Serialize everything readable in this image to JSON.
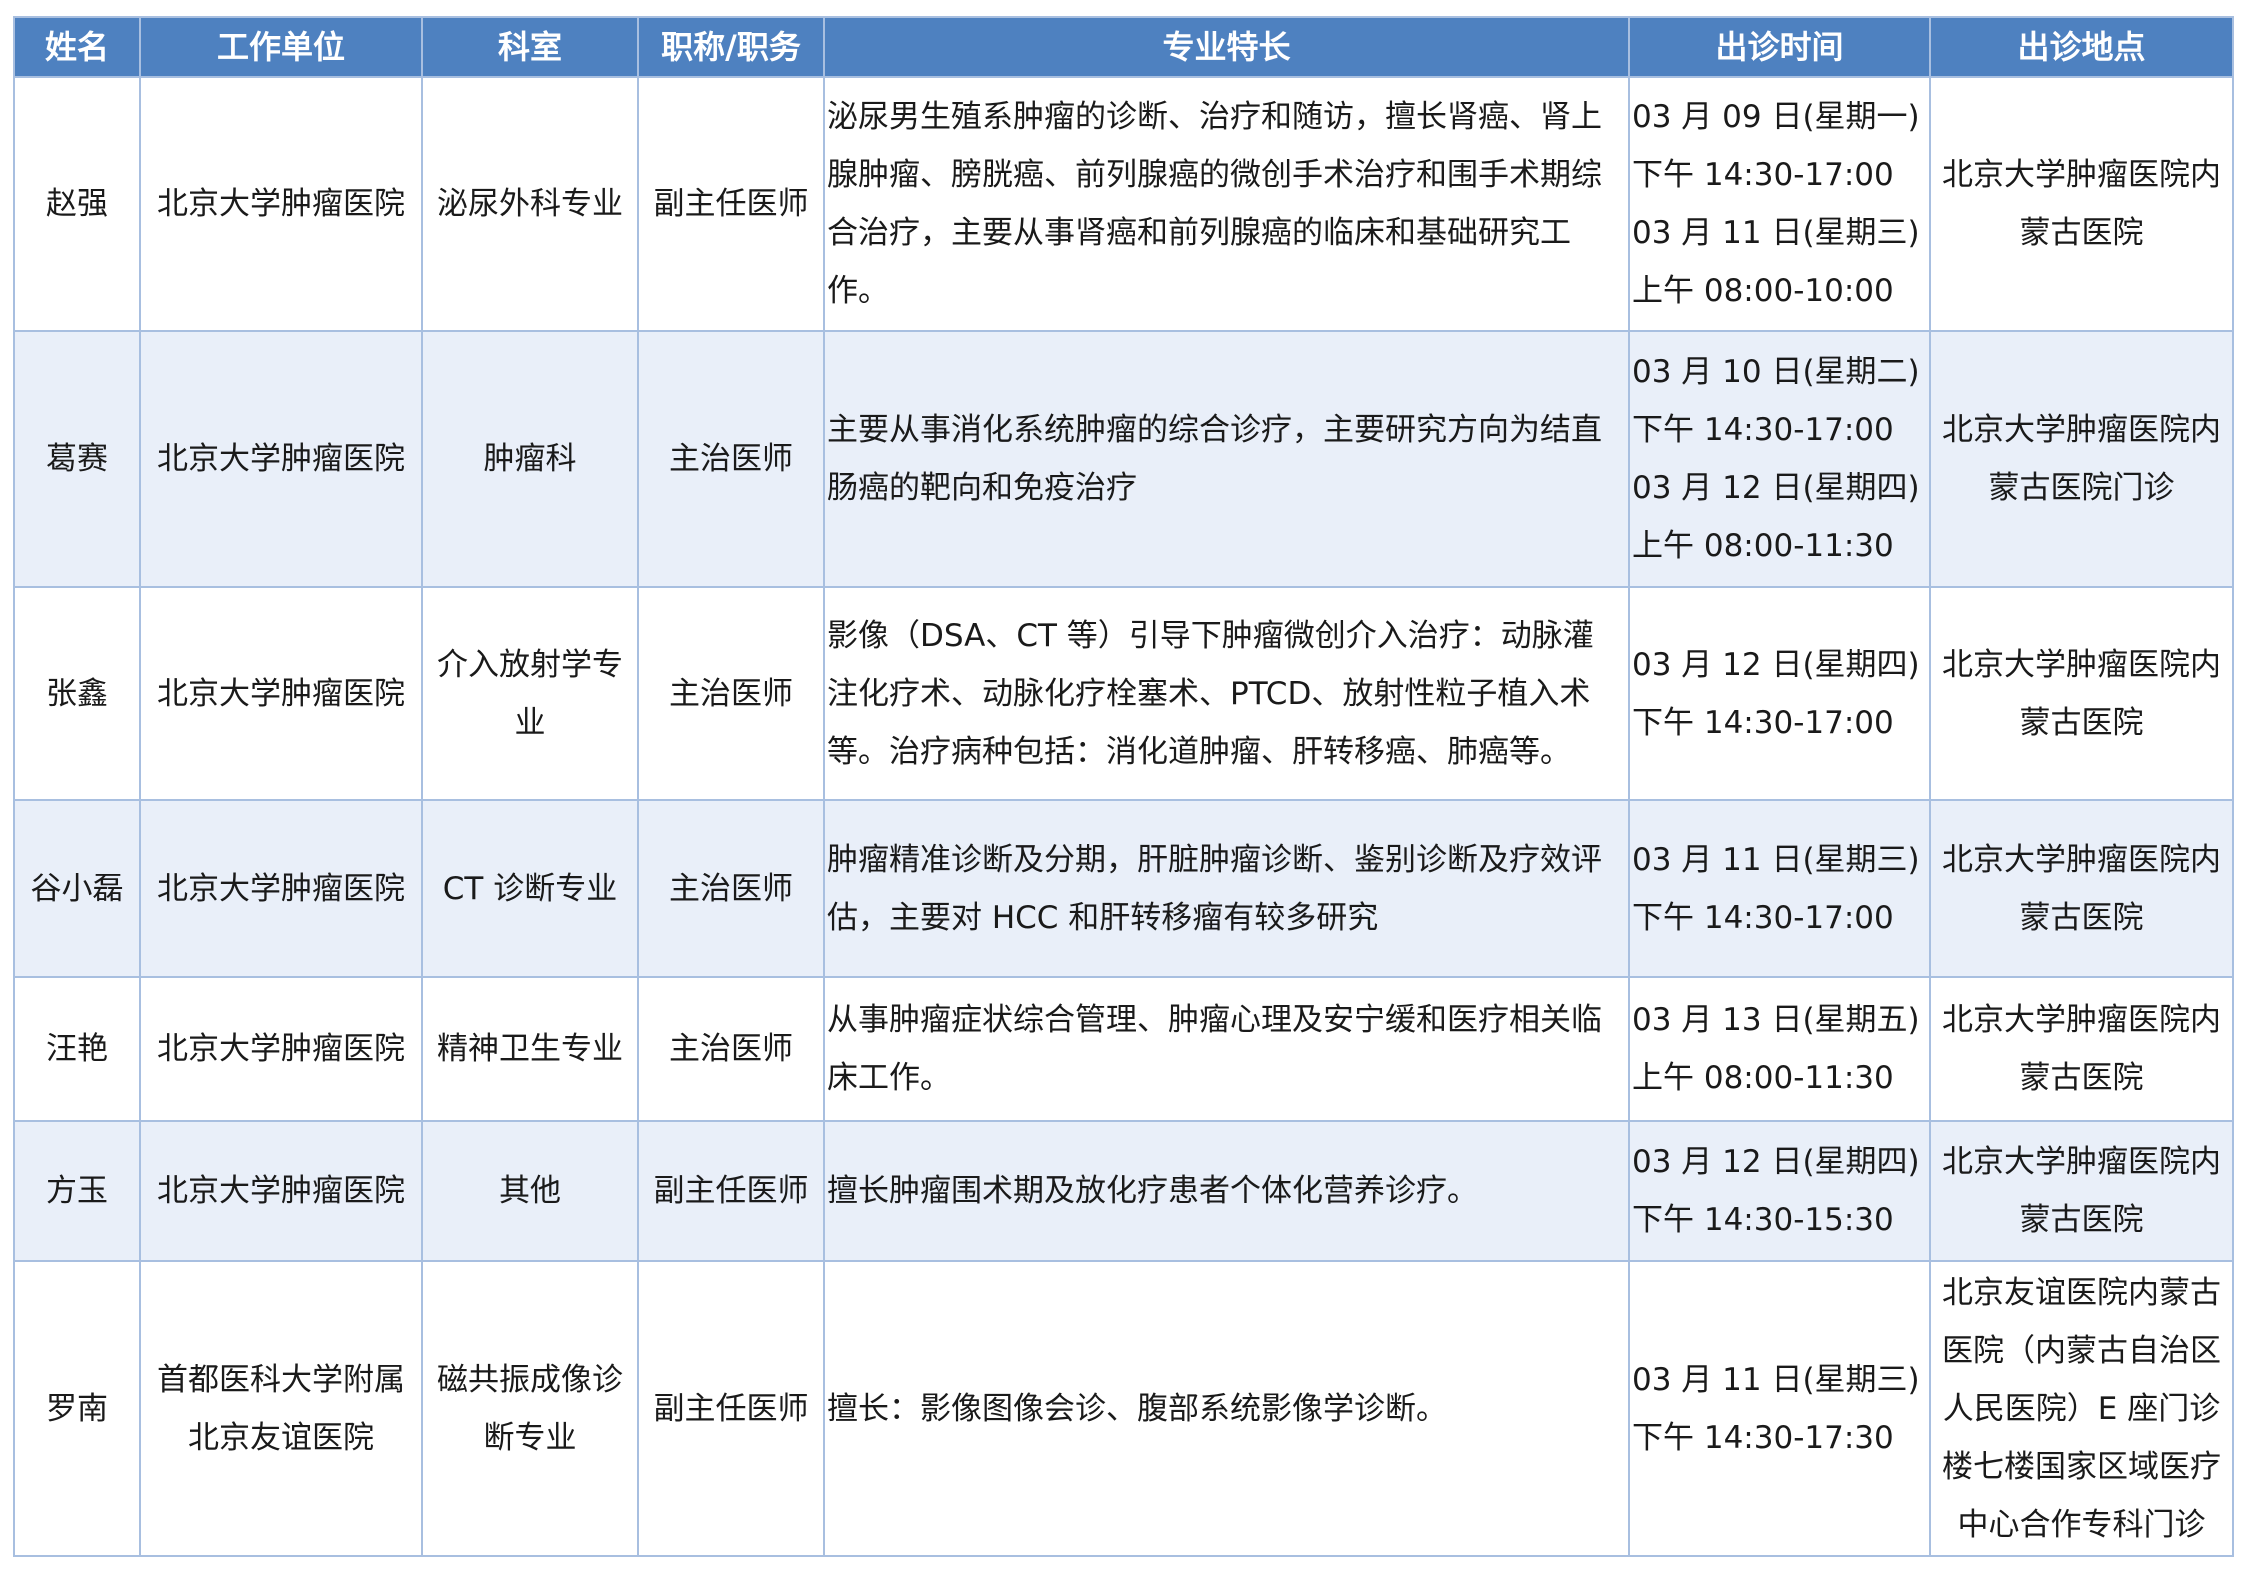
{
  "table": {
    "headers": [
      "姓名",
      "工作单位",
      "科室",
      "职称/职务",
      "专业特长",
      "出诊时间",
      "出诊地点"
    ],
    "rows": [
      {
        "name": "赵强",
        "unit": [
          "北京大学肿瘤医院"
        ],
        "dept": [
          "泌尿外科专业"
        ],
        "title": "副主任医师",
        "specialty": [
          "泌尿男生殖系肿瘤的诊断、治疗和随访，擅长肾癌、肾上",
          "腺肿瘤、膀胱癌、前列腺癌的微创手术治疗和围手术期综",
          "合治疗，主要从事肾癌和前列腺癌的临床和基础研究工",
          "作。"
        ],
        "time": [
          "03 月 09 日(星期一)",
          "下午 14:30-17:00",
          "03 月 11 日(星期三)",
          "上午 08:00-10:00"
        ],
        "place": [
          "北京大学肿瘤医院内",
          "蒙古医院"
        ]
      },
      {
        "name": "葛赛",
        "unit": [
          "北京大学肿瘤医院"
        ],
        "dept": [
          "肿瘤科"
        ],
        "title": "主治医师",
        "specialty": [
          "主要从事消化系统肿瘤的综合诊疗，主要研究方向为结直",
          "肠癌的靶向和免疫治疗"
        ],
        "time": [
          "03 月 10 日(星期二)",
          "下午 14:30-17:00",
          "03 月 12 日(星期四)",
          "上午 08:00-11:30"
        ],
        "place": [
          "北京大学肿瘤医院内",
          "蒙古医院门诊"
        ]
      },
      {
        "name": "张鑫",
        "unit": [
          "北京大学肿瘤医院"
        ],
        "dept": [
          "介入放射学专",
          "业"
        ],
        "title": "主治医师",
        "specialty": [
          "影像（DSA、CT 等）引导下肿瘤微创介入治疗：动脉灌",
          "注化疗术、动脉化疗栓塞术、PTCD、放射性粒子植入术",
          "等。治疗病种包括：消化道肿瘤、肝转移癌、肺癌等。"
        ],
        "time": [
          "03 月 12 日(星期四)",
          "下午 14:30-17:00"
        ],
        "place": [
          "北京大学肿瘤医院内",
          "蒙古医院"
        ]
      },
      {
        "name": "谷小磊",
        "unit": [
          "北京大学肿瘤医院"
        ],
        "dept": [
          "CT 诊断专业"
        ],
        "title": "主治医师",
        "specialty": [
          "肿瘤精准诊断及分期，肝脏肿瘤诊断、鉴别诊断及疗效评",
          "估，主要对 HCC 和肝转移瘤有较多研究"
        ],
        "time": [
          "03 月 11 日(星期三)",
          "下午 14:30-17:00"
        ],
        "place": [
          "北京大学肿瘤医院内",
          "蒙古医院"
        ]
      },
      {
        "name": "汪艳",
        "unit": [
          "北京大学肿瘤医院"
        ],
        "dept": [
          "精神卫生专业"
        ],
        "title": "主治医师",
        "specialty": [
          "从事肿瘤症状综合管理、肿瘤心理及安宁缓和医疗相关临",
          "床工作。"
        ],
        "time": [
          "03 月 13 日(星期五)",
          "上午 08:00-11:30"
        ],
        "place": [
          "北京大学肿瘤医院内",
          "蒙古医院"
        ]
      },
      {
        "name": "方玉",
        "unit": [
          "北京大学肿瘤医院"
        ],
        "dept": [
          "其他"
        ],
        "title": "副主任医师",
        "specialty": [
          "擅长肿瘤围术期及放化疗患者个体化营养诊疗。"
        ],
        "time": [
          "03 月 12 日(星期四)",
          "下午 14:30-15:30"
        ],
        "place": [
          "北京大学肿瘤医院内",
          "蒙古医院"
        ]
      },
      {
        "name": "罗南",
        "unit": [
          "首都医科大学附属",
          "北京友谊医院"
        ],
        "dept": [
          "磁共振成像诊",
          "断专业"
        ],
        "title": "副主任医师",
        "specialty": [
          "擅长：影像图像会诊、腹部系统影像学诊断。"
        ],
        "time": [
          "03 月 11 日(星期三)",
          "下午 14:30-17:30"
        ],
        "place": [
          "北京友谊医院内蒙古",
          "医院（内蒙古自治区",
          "人民医院）E 座门诊",
          "楼七楼国家区域医疗",
          "中心合作专科门诊"
        ]
      }
    ]
  }
}
